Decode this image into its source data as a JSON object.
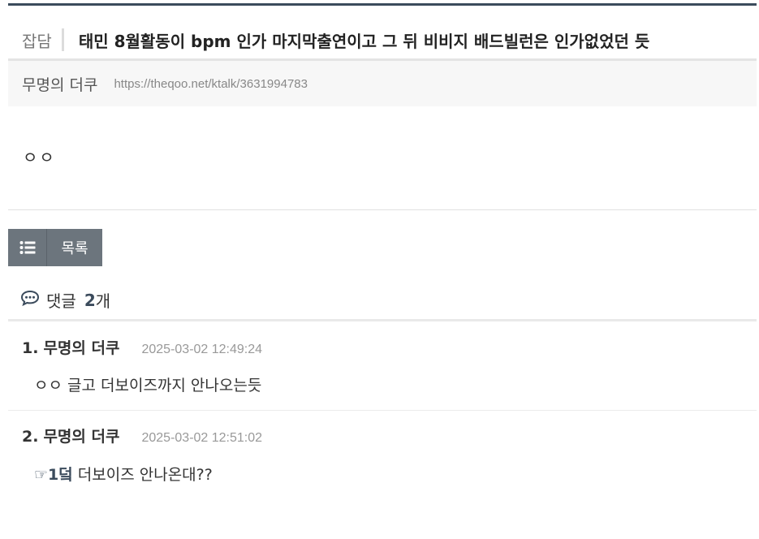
{
  "post": {
    "category": "잡담",
    "title": "태민 8월활동이 bpm 인가 마지막출연이고 그 뒤 비비지 배드빌런은 인가없었던 듯",
    "author": "무명의 더쿠",
    "url": "https://theqoo.net/ktalk/3631994783",
    "body": "ㅇㅇ"
  },
  "list_button": {
    "label": "목록",
    "icon": "list-icon"
  },
  "comments_header": {
    "label": "댓글",
    "count": "2",
    "unit": "개",
    "icon": "comment-icon"
  },
  "comments": [
    {
      "number": "1.",
      "author": "무명의 더쿠",
      "date": "2025-03-02 12:49:24",
      "body": "ㅇㅇ 글고 더보이즈까지 안나오는듯"
    },
    {
      "number": "2.",
      "author": "무명의 더쿠",
      "date": "2025-03-02 12:51:02",
      "reply_ref": "☞1덬",
      "body": " 더보이즈 안나온대??"
    }
  ],
  "colors": {
    "accent": "#3b4b5c",
    "button_bg": "#6c757d",
    "meta_bg": "#f7f7f7"
  }
}
